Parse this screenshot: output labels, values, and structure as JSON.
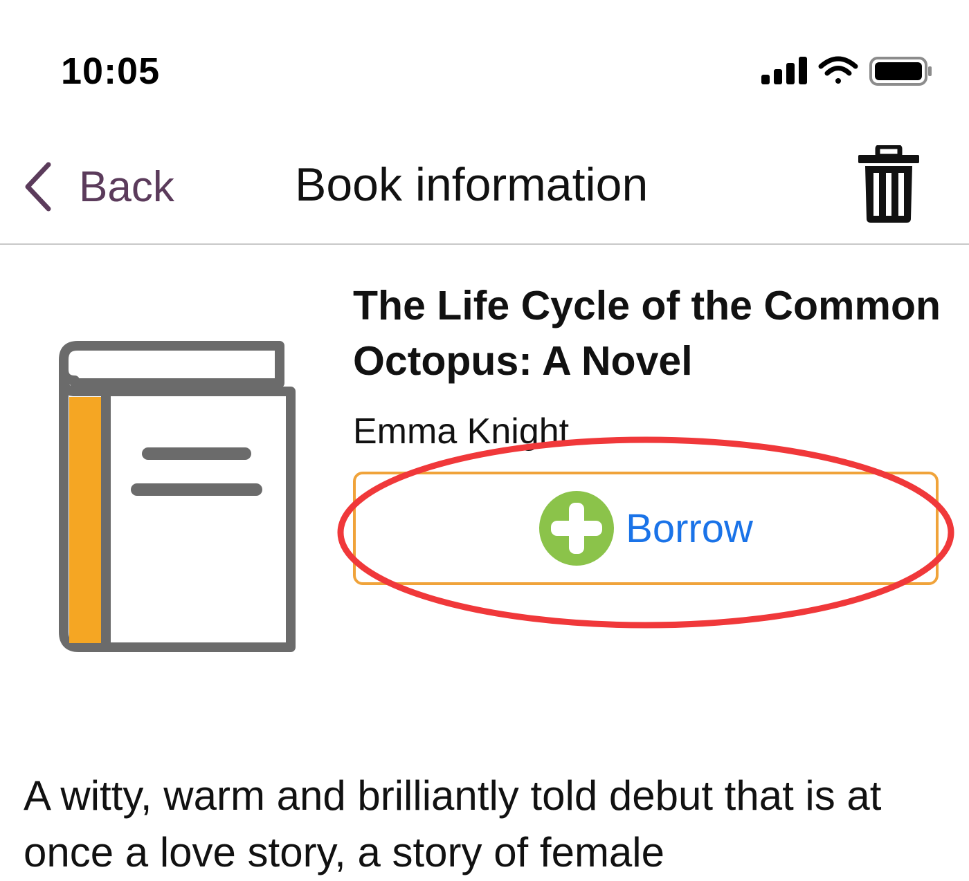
{
  "status_bar": {
    "time": "10:05"
  },
  "nav": {
    "back_label": "Back",
    "title": "Book information"
  },
  "book": {
    "title": "The Life Cycle of the Common Octopus: A Novel",
    "author": "Emma Knight",
    "description": "A witty, warm and brilliantly told debut that is at once a love story, a story of female"
  },
  "borrow": {
    "label": "Borrow"
  },
  "colors": {
    "back_tint": "#5b3b5b",
    "borrow_text": "#1a73e8",
    "borrow_border": "#f0a33a",
    "plus_icon": "#8bc34a",
    "book_spine": "#f5a623",
    "book_outline": "#6b6b6b",
    "highlight_ring": "#f0383a"
  },
  "icons": {
    "signal": "cellular-signal-icon",
    "wifi": "wifi-icon",
    "battery": "battery-icon",
    "back": "chevron-left-icon",
    "trash": "trash-icon",
    "book": "book-icon",
    "plus": "plus-circle-icon"
  }
}
